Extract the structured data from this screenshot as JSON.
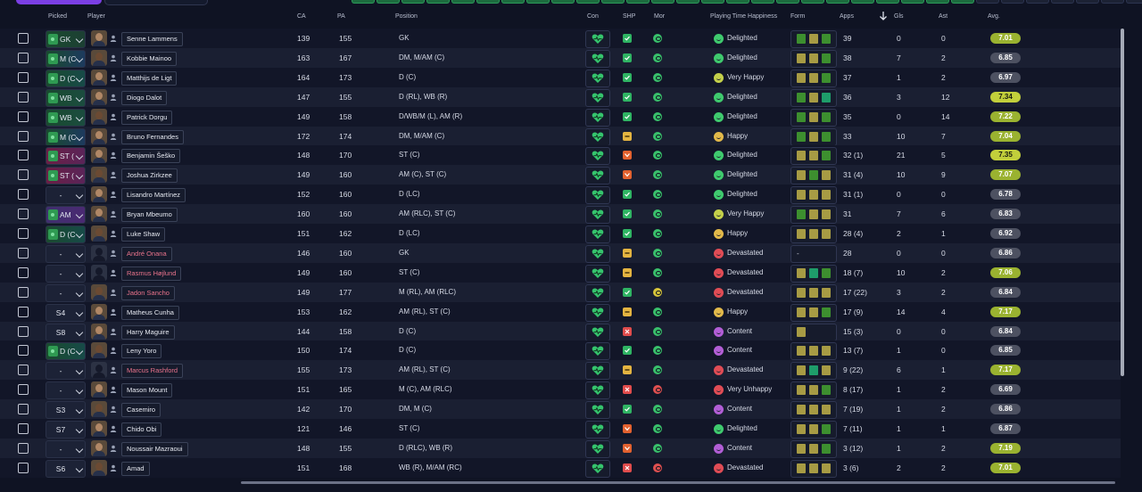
{
  "header": {
    "picked": "Picked",
    "player": "Player",
    "ca": "CA",
    "pa": "PA",
    "position": "Position",
    "con": "Con",
    "shp": "SHP",
    "mor": "Mor",
    "pth": "Playing Time Happiness",
    "form": "Form",
    "apps": "Apps",
    "gls": "Gls",
    "ast": "Ast",
    "avg": "Avg."
  },
  "colors": {
    "accent": "#7b3fe4",
    "form_green": "#3d8f2f",
    "form_olive": "#a79b44",
    "form_teal": "#1e9d6a"
  },
  "rows": [
    {
      "picked": "GK",
      "picked_style": "gk",
      "name": "Senne Lammens",
      "ca": "139",
      "pa": "155",
      "position": "GK",
      "shp": "ok",
      "mor": "g",
      "hap": "Delighted",
      "hap_style": "delighted",
      "form": [
        "g",
        "o",
        "g"
      ],
      "apps": "39",
      "gls": "0",
      "ast": "0",
      "avg": "7.01",
      "avg_style": "good"
    },
    {
      "picked": "M (C",
      "picked_style": "mid",
      "name": "Kobbie Mainoo",
      "ca": "163",
      "pa": "167",
      "position": "DM, M/AM (C)",
      "shp": "ok",
      "mor": "g",
      "hap": "Delighted",
      "hap_style": "delighted",
      "form": [
        "o",
        "o",
        "g"
      ],
      "apps": "38",
      "gls": "7",
      "ast": "2",
      "avg": "6.85",
      "avg_style": "norm"
    },
    {
      "picked": "D (C",
      "picked_style": "def",
      "name": "Matthijs de Ligt",
      "ca": "164",
      "pa": "173",
      "position": "D (C)",
      "shp": "ok",
      "mor": "g",
      "hap": "Very Happy",
      "hap_style": "veryhappy",
      "form": [
        "o",
        "o",
        "g"
      ],
      "apps": "37",
      "gls": "1",
      "ast": "2",
      "avg": "6.97",
      "avg_style": "norm"
    },
    {
      "picked": "WB",
      "picked_style": "wb",
      "name": "Diogo Dalot",
      "ca": "147",
      "pa": "155",
      "position": "D (RL), WB (R)",
      "shp": "ok",
      "mor": "g",
      "hap": "Delighted",
      "hap_style": "delighted",
      "form": [
        "g",
        "o",
        "t"
      ],
      "apps": "36",
      "gls": "3",
      "ast": "12",
      "avg": "7.34",
      "avg_style": "great"
    },
    {
      "picked": "WB",
      "picked_style": "wb",
      "name": "Patrick Dorgu",
      "ca": "149",
      "pa": "158",
      "position": "D/WB/M (L), AM (R)",
      "shp": "ok",
      "mor": "g",
      "hap": "Delighted",
      "hap_style": "delighted",
      "form": [
        "g",
        "o",
        "g"
      ],
      "apps": "35",
      "gls": "0",
      "ast": "14",
      "avg": "7.22",
      "avg_style": "good"
    },
    {
      "picked": "M (C",
      "picked_style": "mid",
      "name": "Bruno Fernandes",
      "ca": "172",
      "pa": "174",
      "position": "DM, M/AM (C)",
      "shp": "mid",
      "mor": "g",
      "hap": "Happy",
      "hap_style": "happy",
      "form": [
        "g",
        "o",
        "g"
      ],
      "apps": "33",
      "gls": "10",
      "ast": "7",
      "avg": "7.04",
      "avg_style": "good"
    },
    {
      "picked": "ST (",
      "picked_style": "att",
      "name": "Benjamin Šeško",
      "ca": "148",
      "pa": "170",
      "position": "ST (C)",
      "shp": "bad",
      "mor": "g",
      "hap": "Delighted",
      "hap_style": "delighted",
      "form": [
        "o",
        "o",
        "g"
      ],
      "apps": "32 (1)",
      "gls": "21",
      "ast": "5",
      "avg": "7.35",
      "avg_style": "great"
    },
    {
      "picked": "ST (",
      "picked_style": "att",
      "name": "Joshua Zirkzee",
      "ca": "149",
      "pa": "160",
      "position": "AM (C), ST (C)",
      "shp": "bad",
      "mor": "g",
      "hap": "Delighted",
      "hap_style": "delighted",
      "form": [
        "o",
        "g",
        "o"
      ],
      "apps": "31 (4)",
      "gls": "10",
      "ast": "9",
      "avg": "7.07",
      "avg_style": "good"
    },
    {
      "picked": "-",
      "picked_style": "none",
      "name": "Lisandro Martínez",
      "ca": "152",
      "pa": "160",
      "position": "D (LC)",
      "shp": "ok",
      "mor": "g",
      "hap": "Delighted",
      "hap_style": "delighted",
      "form": [
        "o",
        "o",
        "o"
      ],
      "apps": "31 (1)",
      "gls": "0",
      "ast": "0",
      "avg": "6.78",
      "avg_style": "norm"
    },
    {
      "picked": "AM",
      "picked_style": "amp",
      "name": "Bryan Mbeumo",
      "ca": "160",
      "pa": "160",
      "position": "AM (RLC), ST (C)",
      "shp": "ok",
      "mor": "g",
      "hap": "Very Happy",
      "hap_style": "veryhappy",
      "form": [
        "g",
        "o",
        "o"
      ],
      "apps": "31",
      "gls": "7",
      "ast": "6",
      "avg": "6.83",
      "avg_style": "norm"
    },
    {
      "picked": "D (C",
      "picked_style": "def",
      "name": "Luke Shaw",
      "ca": "151",
      "pa": "162",
      "position": "D (LC)",
      "shp": "ok",
      "mor": "g",
      "hap": "Happy",
      "hap_style": "happy",
      "form": [
        "o",
        "o",
        "o"
      ],
      "apps": "28 (4)",
      "gls": "2",
      "ast": "1",
      "avg": "6.92",
      "avg_style": "norm"
    },
    {
      "picked": "-",
      "picked_style": "none",
      "name": "André Onana",
      "name_warn": true,
      "ca": "146",
      "pa": "160",
      "position": "GK",
      "shp": "mid",
      "mor": "g",
      "hap": "Devastated",
      "hap_style": "devastated",
      "form": [
        "dash"
      ],
      "apps": "28",
      "gls": "0",
      "ast": "0",
      "avg": "6.86",
      "avg_style": "norm"
    },
    {
      "picked": "-",
      "picked_style": "none",
      "name": "Rasmus Højlund",
      "name_warn": true,
      "ca": "149",
      "pa": "160",
      "position": "ST (C)",
      "shp": "mid",
      "mor": "g",
      "hap": "Devastated",
      "hap_style": "devastated",
      "form": [
        "o",
        "t",
        "g"
      ],
      "apps": "18 (7)",
      "gls": "10",
      "ast": "2",
      "avg": "7.06",
      "avg_style": "good"
    },
    {
      "picked": "-",
      "picked_style": "none",
      "name": "Jadon Sancho",
      "name_warn": true,
      "ca": "149",
      "pa": "177",
      "position": "M (RL), AM (RLC)",
      "shp": "ok",
      "mor": "y",
      "hap": "Devastated",
      "hap_style": "devastated",
      "form": [
        "o",
        "o",
        "o"
      ],
      "apps": "17 (22)",
      "gls": "3",
      "ast": "2",
      "avg": "6.84",
      "avg_style": "norm"
    },
    {
      "picked": "S4",
      "picked_style": "none",
      "name": "Matheus Cunha",
      "ca": "153",
      "pa": "162",
      "position": "AM (RL), ST (C)",
      "shp": "mid",
      "mor": "g",
      "hap": "Happy",
      "hap_style": "happy",
      "form": [
        "o",
        "o",
        "g"
      ],
      "apps": "17 (9)",
      "gls": "14",
      "ast": "4",
      "avg": "7.17",
      "avg_style": "good"
    },
    {
      "picked": "S8",
      "picked_style": "none",
      "name": "Harry Maguire",
      "ca": "144",
      "pa": "158",
      "position": "D (C)",
      "shp": "x",
      "mor": "g",
      "hap": "Content",
      "hap_style": "content",
      "form": [
        "o"
      ],
      "apps": "15 (3)",
      "gls": "0",
      "ast": "0",
      "avg": "6.84",
      "avg_style": "norm"
    },
    {
      "picked": "D (C",
      "picked_style": "def",
      "name": "Leny Yoro",
      "ca": "150",
      "pa": "174",
      "position": "D (C)",
      "shp": "ok",
      "mor": "g",
      "hap": "Content",
      "hap_style": "content",
      "form": [
        "o",
        "o",
        "o"
      ],
      "apps": "13 (7)",
      "gls": "1",
      "ast": "0",
      "avg": "6.85",
      "avg_style": "norm"
    },
    {
      "picked": "-",
      "picked_style": "none",
      "name": "Marcus Rashford",
      "name_warn": true,
      "ca": "155",
      "pa": "173",
      "position": "AM (RL), ST (C)",
      "shp": "mid",
      "mor": "g",
      "hap": "Devastated",
      "hap_style": "devastated",
      "form": [
        "o",
        "t",
        "o"
      ],
      "apps": "9 (22)",
      "gls": "6",
      "ast": "1",
      "avg": "7.17",
      "avg_style": "good"
    },
    {
      "picked": "-",
      "picked_style": "none",
      "name": "Mason Mount",
      "ca": "151",
      "pa": "165",
      "position": "M (C), AM (RLC)",
      "shp": "x",
      "mor": "r",
      "hap": "Very Unhappy",
      "hap_style": "unhappy",
      "form": [
        "o",
        "o",
        "g"
      ],
      "apps": "8 (17)",
      "gls": "1",
      "ast": "2",
      "avg": "6.69",
      "avg_style": "norm"
    },
    {
      "picked": "S3",
      "picked_style": "none",
      "name": "Casemiro",
      "ca": "142",
      "pa": "170",
      "position": "DM, M (C)",
      "shp": "ok",
      "mor": "g",
      "hap": "Content",
      "hap_style": "content",
      "form": [
        "o",
        "o",
        "o"
      ],
      "apps": "7 (19)",
      "gls": "1",
      "ast": "2",
      "avg": "6.86",
      "avg_style": "norm"
    },
    {
      "picked": "S7",
      "picked_style": "none",
      "name": "Chido Obi",
      "ca": "121",
      "pa": "146",
      "position": "ST (C)",
      "shp": "bad",
      "mor": "g",
      "hap": "Delighted",
      "hap_style": "delighted",
      "form": [
        "o",
        "o",
        "g"
      ],
      "apps": "7 (11)",
      "gls": "1",
      "ast": "1",
      "avg": "6.87",
      "avg_style": "norm"
    },
    {
      "picked": "-",
      "picked_style": "none",
      "name": "Noussair Mazraoui",
      "ca": "148",
      "pa": "155",
      "position": "D (RLC), WB (R)",
      "shp": "bad",
      "mor": "g",
      "hap": "Content",
      "hap_style": "content",
      "form": [
        "o",
        "o",
        "g"
      ],
      "apps": "3 (12)",
      "gls": "1",
      "ast": "2",
      "avg": "7.19",
      "avg_style": "good"
    },
    {
      "picked": "S6",
      "picked_style": "none",
      "name": "Amad",
      "ca": "151",
      "pa": "168",
      "position": "WB (R), M/AM (RC)",
      "shp": "x",
      "mor": "r",
      "hap": "Devastated",
      "hap_style": "devastated",
      "form": [
        "o",
        "o",
        "o"
      ],
      "apps": "3 (6)",
      "gls": "2",
      "ast": "2",
      "avg": "7.01",
      "avg_style": "good"
    }
  ]
}
